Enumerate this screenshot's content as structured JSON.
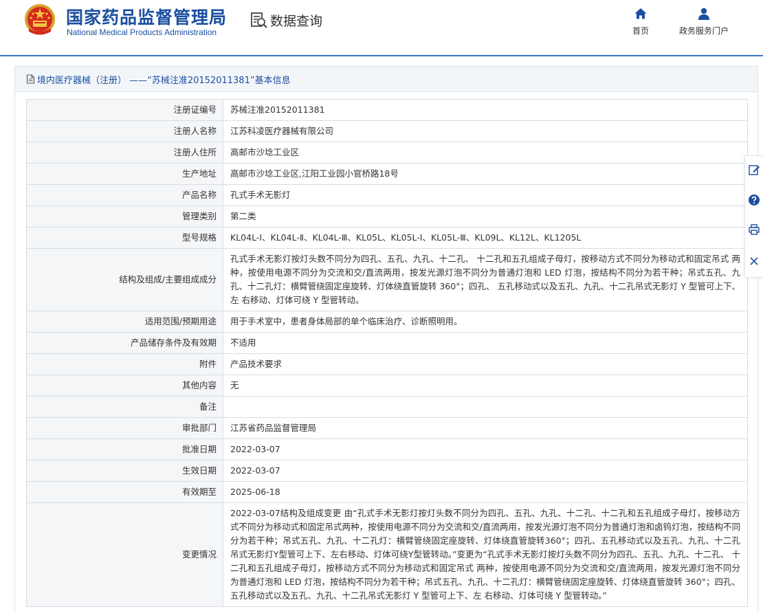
{
  "header": {
    "logo_cn": "国家药品监督管理局",
    "logo_en": "National Medical Products Administration",
    "query_label": "数据查询",
    "nav": {
      "home": "首页",
      "portal": "政务服务门户"
    }
  },
  "panel": {
    "title": "境内医疗器械（注册） ——“苏械注准20152011381”基本信息"
  },
  "rows": [
    {
      "label": "注册证编号",
      "value": "苏械注准20152011381"
    },
    {
      "label": "注册人名称",
      "value": "江苏科凌医疗器械有限公司"
    },
    {
      "label": "注册人住所",
      "value": "高邮市沙埝工业区"
    },
    {
      "label": "生产地址",
      "value": "高邮市沙埝工业区,江阳工业园小官桥路18号"
    },
    {
      "label": "产品名称",
      "value": "孔式手术无影灯"
    },
    {
      "label": "管理类别",
      "value": "第二类"
    },
    {
      "label": "型号规格",
      "value": "KL04L-Ⅰ、KL04L-Ⅱ、KL04L-Ⅲ、KL05L、KL05L-Ⅰ、KL05L-Ⅲ、KL09L、KL12L、KL1205L"
    },
    {
      "label": "结构及组成/主要组成成分",
      "value": "孔式手术无影灯按灯头数不同分为四孔、五孔、九孔、十二孔、 十二孔和五孔组成子母灯，按移动方式不同分为移动式和固定吊式 两种，按使用电源不同分为交流和交/直流两用，按发光源灯泡不同分为普通灯泡和 LED 灯泡，按结构不同分为若干种；吊式五孔、九孔、十二孔灯：横臂管绕固定座旋转、灯体绕直管旋转 360°；四孔、 五孔移动式以及五孔、九孔、十二孔吊式无影灯 Y 型管可上下、左 右移动、灯体可绕 Y 型管转动。"
    },
    {
      "label": "适用范围/预期用途",
      "value": "用于手术室中，患者身体局部的单个临床治疗、诊断照明用。"
    },
    {
      "label": "产品储存条件及有效期",
      "value": "不适用"
    },
    {
      "label": "附件",
      "value": "产品技术要求"
    },
    {
      "label": "其他内容",
      "value": "无"
    },
    {
      "label": "备注",
      "value": ""
    },
    {
      "label": "审批部门",
      "value": "江苏省药品监督管理局"
    },
    {
      "label": "批准日期",
      "value": "2022-03-07"
    },
    {
      "label": "生效日期",
      "value": "2022-03-07"
    },
    {
      "label": "有效期至",
      "value": "2025-06-18"
    },
    {
      "label": "变更情况",
      "value": "2022-03-07结构及组成变更 由“孔式手术无影灯按灯头数不同分为四孔、五孔、九孔、十二孔、十二孔和五孔组成子母灯，按移动方式不同分为移动式和固定吊式两种，按使用电源不同分为交流和交/直流两用，按发光源灯泡不同分为普通灯泡和卤钨灯泡，按结构不同分为若干种；吊式五孔、九孔、十二孔灯：横臂管绕固定座旋转、灯体绕直管旋转360°；四孔、五孔移动式以及五孔、九孔、十二孔吊式无影灯Y型管可上下、左右移动、灯体可绕Y型管转动。”变更为“孔式手术无影灯按灯头数不同分为四孔、五孔、九孔、十二孔、 十二孔和五孔组成子母灯，按移动方式不同分为移动式和固定吊式 两种，按使用电源不同分为交流和交/直流两用，按发光源灯泡不同分为普通灯泡和 LED 灯泡，按结构不同分为若干种；吊式五孔、九孔、十二孔灯：横臂管绕固定座旋转、灯体绕直管旋转 360°；四孔、 五孔移动式以及五孔、九孔、十二孔吊式无影灯 Y 型管可上下、左 右移动、灯体可绕 Y 型管转动。”"
    }
  ],
  "icons": {
    "emblem": "national-emblem-icon",
    "query": "data-query-icon",
    "home": "home-icon",
    "portal": "user-icon",
    "doc": "document-icon",
    "side": [
      "edit-icon",
      "help-icon",
      "print-icon",
      "close-icon"
    ]
  },
  "colors": {
    "brand": "#1b4ea0",
    "header_line": "#3b74c4",
    "label_bg": "#f4f6f8",
    "border": "#d8dde3"
  }
}
